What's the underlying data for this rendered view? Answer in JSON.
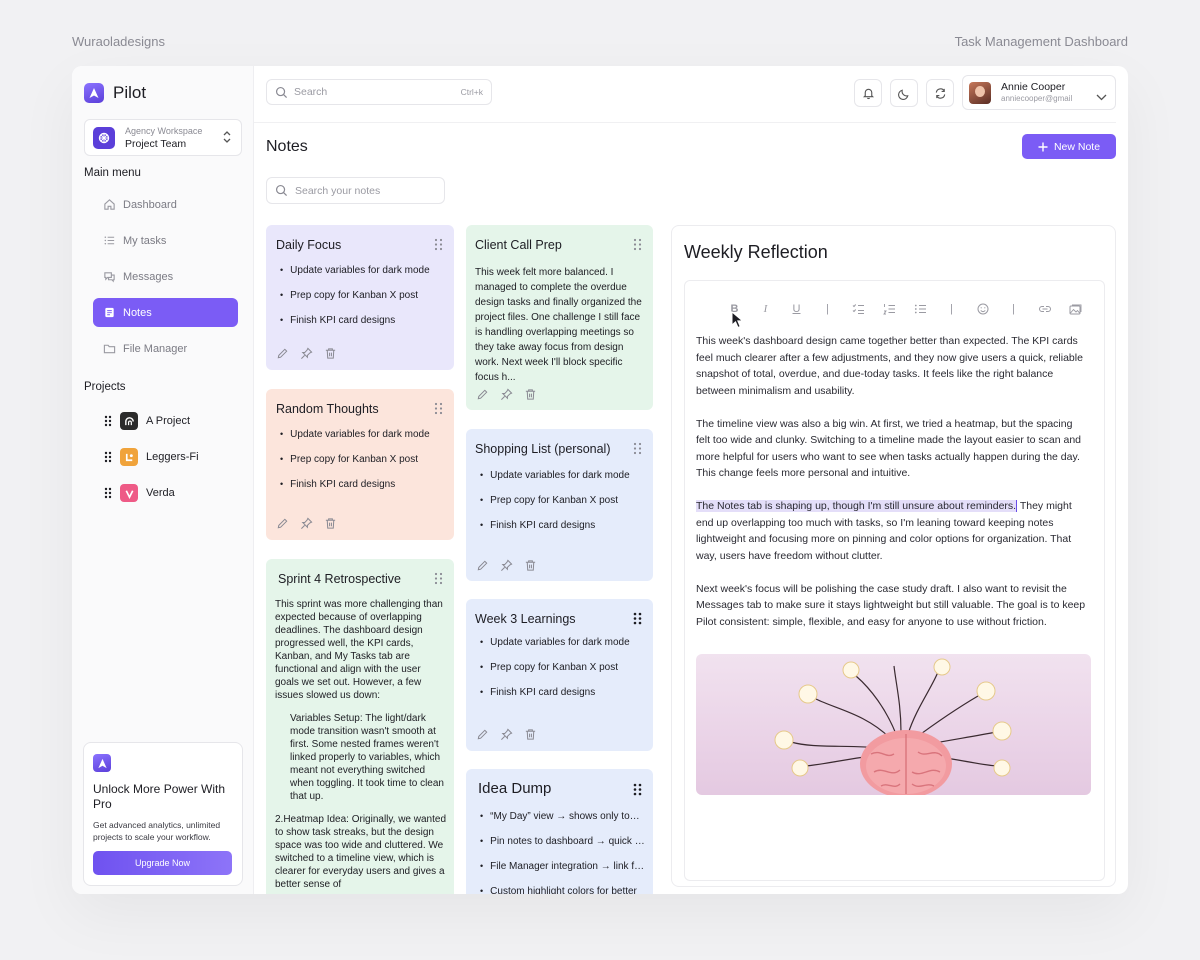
{
  "meta": {
    "left_label": "Wuraoladesigns",
    "right_label": "Task Management Dashboard"
  },
  "brand": {
    "name": "Pilot",
    "color": "#7b5cf5"
  },
  "workspace": {
    "subtitle": "Agency Workspace",
    "name": "Project Team"
  },
  "menu": {
    "label": "Main menu",
    "items": [
      {
        "label": "Dashboard",
        "icon": "home-icon"
      },
      {
        "label": "My tasks",
        "icon": "list-icon"
      },
      {
        "label": "Messages",
        "icon": "chat-icon"
      },
      {
        "label": "Notes",
        "icon": "note-icon",
        "active": true
      },
      {
        "label": "File Manager",
        "icon": "folder-icon"
      }
    ]
  },
  "projects": {
    "label": "Projects",
    "items": [
      {
        "label": "A Project",
        "color": "#2b2b2b"
      },
      {
        "label": "Leggers-Fi",
        "color": "#f0a33b"
      },
      {
        "label": "Verda",
        "color": "#ee5a86"
      }
    ]
  },
  "promo": {
    "title": "Unlock More Power With Pro",
    "text": "Get advanced analytics, unlimited projects to scale your workflow.",
    "button": "Upgrade Now"
  },
  "header": {
    "search_placeholder": "Search",
    "search_shortcut": "Ctrl+k",
    "user_name": "Annie Cooper",
    "user_email": "anniecooper@gmail"
  },
  "page": {
    "title": "Notes",
    "new_note": "New Note",
    "notes_search_placeholder": "Search your notes"
  },
  "cards": {
    "daily": {
      "title": "Daily Focus",
      "items": [
        "Update variables for dark mode",
        "Prep copy for Kanban X post",
        "Finish KPI card designs"
      ]
    },
    "random": {
      "title": "Random Thoughts",
      "items": [
        "Update variables for dark mode",
        "Prep copy for Kanban X post",
        "Finish KPI card designs"
      ]
    },
    "sprint": {
      "title": "Sprint 4 Retrospective",
      "intro": "This sprint was more challenging than expected because of overlapping deadlines. The dashboard design progressed well, the KPI cards, Kanban, and My Tasks tab are functional and align with the user goals we set out. However, a few issues slowed us down:",
      "point1": "Variables Setup: The light/dark mode transition wasn't smooth at first. Some nested frames weren't linked properly to variables, which meant not everything switched when toggling. It took time to clean that up.",
      "point2": "2.Heatmap Idea: Originally, we wanted to show task streaks, but the design space was too wide and cluttered. We switched to a timeline view, which is clearer for everyday users and gives a better sense of"
    },
    "client": {
      "title": "Client Call Prep",
      "text": "This week felt more balanced. I managed to complete the overdue design tasks and finally organized the project files. One challenge I still face is handling overlapping meetings so they take away focus from design work. Next week I'll block specific focus h..."
    },
    "shopping": {
      "title": "Shopping List (personal)",
      "items": [
        "Update variables for dark mode",
        "Prep copy for Kanban X post",
        "Finish KPI card designs"
      ]
    },
    "week3": {
      "title": "Week 3 Learnings",
      "items": [
        "Update variables for dark mode",
        "Prep copy for Kanban X post",
        "Finish KPI card designs"
      ]
    },
    "idea": {
      "title": "Idea Dump",
      "items": [
        "“My Day” view → shows only today's tasks",
        "Pin notes to dashboard → quick reference",
        "File Manager integration → link files",
        "Custom highlight colors for better"
      ]
    }
  },
  "editor": {
    "title": "Weekly Reflection",
    "toolbar": {
      "bold": "B",
      "italic": "I",
      "underline": "U",
      "sep": "|"
    },
    "p1": "This week's dashboard design came together better than expected. The KPI cards feel much clearer after a few adjustments, and they now give users a quick, reliable snapshot of total, overdue, and due-today tasks. It feels like the right balance between minimalism and usability.",
    "p2": "The timeline view was also a big win. At first, we tried a heatmap, but the spacing felt too wide and clunky. Switching to a timeline made the layout easier to scan and more helpful for users who want to see when tasks actually happen during the day. This change feels more personal and intuitive.",
    "p3_highlight": "The Notes tab is shaping up, though I'm still unsure about reminders.",
    "p3_rest": " They might end up overlapping too much with tasks, so I'm leaning toward keeping notes lightweight and focusing more on pinning and color options for organization. That way, users have freedom without clutter.",
    "p4": "Next week's focus will be polishing the case study draft. I also want to revisit the Messages tab to make sure it stays lightweight but still valuable. The goal is to keep Pilot consistent: simple, flexible, and easy for anyone to use without friction."
  }
}
